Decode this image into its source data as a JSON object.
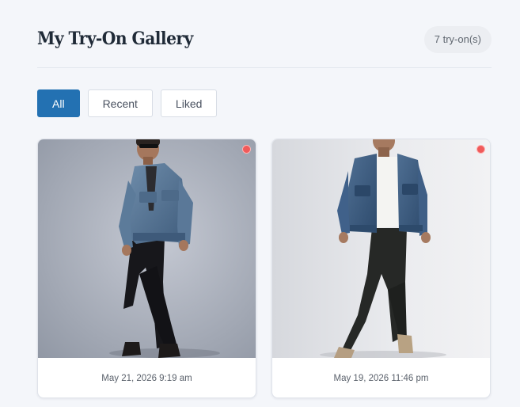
{
  "header": {
    "title": "My Try-On Gallery",
    "count_label": "7 try-on(s)"
  },
  "filters": [
    {
      "label": "All",
      "active": true
    },
    {
      "label": "Recent",
      "active": false
    },
    {
      "label": "Liked",
      "active": false
    }
  ],
  "gallery": [
    {
      "date": "May 21, 2026 9:19 am",
      "liked": true,
      "image": "man in denim jacket and black jeans, studio gray background"
    },
    {
      "date": "May 19, 2026 11:46 pm",
      "liked": true,
      "image": "man in denim jacket, white tee and dark trousers leaning on white wall"
    }
  ],
  "colors": {
    "accent": "#2371b2",
    "like": "#f05a5a",
    "background": "#f4f6fa"
  }
}
